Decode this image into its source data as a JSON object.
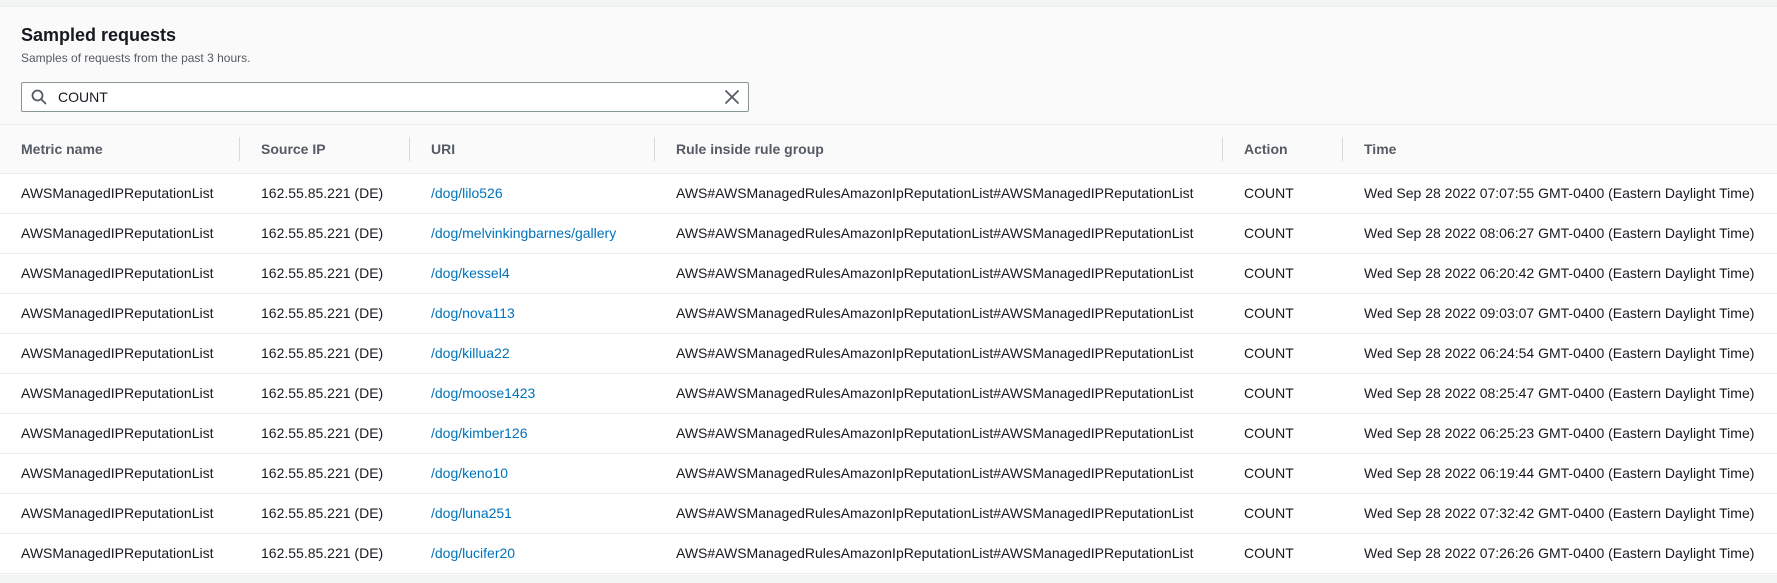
{
  "header": {
    "title": "Sampled requests",
    "subtitle": "Samples of requests from the past 3 hours."
  },
  "search": {
    "value": "COUNT",
    "placeholder": ""
  },
  "icons": {
    "search": "search-icon",
    "clear": "close-icon"
  },
  "colors": {
    "link": "#0073bb",
    "header_bg": "#fafafa",
    "border": "#eaeded"
  },
  "table": {
    "columns": [
      "Metric name",
      "Source IP",
      "URI",
      "Rule inside rule group",
      "Action",
      "Time"
    ],
    "rows": [
      [
        "AWSManagedIPReputationList",
        "162.55.85.221 (DE)",
        "/dog/lilo526",
        "AWS#AWSManagedRulesAmazonIpReputationList#AWSManagedIPReputationList",
        "COUNT",
        "Wed Sep 28 2022 07:07:55 GMT-0400 (Eastern Daylight Time)"
      ],
      [
        "AWSManagedIPReputationList",
        "162.55.85.221 (DE)",
        "/dog/melvinkingbarnes/gallery",
        "AWS#AWSManagedRulesAmazonIpReputationList#AWSManagedIPReputationList",
        "COUNT",
        "Wed Sep 28 2022 08:06:27 GMT-0400 (Eastern Daylight Time)"
      ],
      [
        "AWSManagedIPReputationList",
        "162.55.85.221 (DE)",
        "/dog/kessel4",
        "AWS#AWSManagedRulesAmazonIpReputationList#AWSManagedIPReputationList",
        "COUNT",
        "Wed Sep 28 2022 06:20:42 GMT-0400 (Eastern Daylight Time)"
      ],
      [
        "AWSManagedIPReputationList",
        "162.55.85.221 (DE)",
        "/dog/nova113",
        "AWS#AWSManagedRulesAmazonIpReputationList#AWSManagedIPReputationList",
        "COUNT",
        "Wed Sep 28 2022 09:03:07 GMT-0400 (Eastern Daylight Time)"
      ],
      [
        "AWSManagedIPReputationList",
        "162.55.85.221 (DE)",
        "/dog/killua22",
        "AWS#AWSManagedRulesAmazonIpReputationList#AWSManagedIPReputationList",
        "COUNT",
        "Wed Sep 28 2022 06:24:54 GMT-0400 (Eastern Daylight Time)"
      ],
      [
        "AWSManagedIPReputationList",
        "162.55.85.221 (DE)",
        "/dog/moose1423",
        "AWS#AWSManagedRulesAmazonIpReputationList#AWSManagedIPReputationList",
        "COUNT",
        "Wed Sep 28 2022 08:25:47 GMT-0400 (Eastern Daylight Time)"
      ],
      [
        "AWSManagedIPReputationList",
        "162.55.85.221 (DE)",
        "/dog/kimber126",
        "AWS#AWSManagedRulesAmazonIpReputationList#AWSManagedIPReputationList",
        "COUNT",
        "Wed Sep 28 2022 06:25:23 GMT-0400 (Eastern Daylight Time)"
      ],
      [
        "AWSManagedIPReputationList",
        "162.55.85.221 (DE)",
        "/dog/keno10",
        "AWS#AWSManagedRulesAmazonIpReputationList#AWSManagedIPReputationList",
        "COUNT",
        "Wed Sep 28 2022 06:19:44 GMT-0400 (Eastern Daylight Time)"
      ],
      [
        "AWSManagedIPReputationList",
        "162.55.85.221 (DE)",
        "/dog/luna251",
        "AWS#AWSManagedRulesAmazonIpReputationList#AWSManagedIPReputationList",
        "COUNT",
        "Wed Sep 28 2022 07:32:42 GMT-0400 (Eastern Daylight Time)"
      ],
      [
        "AWSManagedIPReputationList",
        "162.55.85.221 (DE)",
        "/dog/lucifer20",
        "AWS#AWSManagedRulesAmazonIpReputationList#AWSManagedIPReputationList",
        "COUNT",
        "Wed Sep 28 2022 07:26:26 GMT-0400 (Eastern Daylight Time)"
      ]
    ]
  }
}
